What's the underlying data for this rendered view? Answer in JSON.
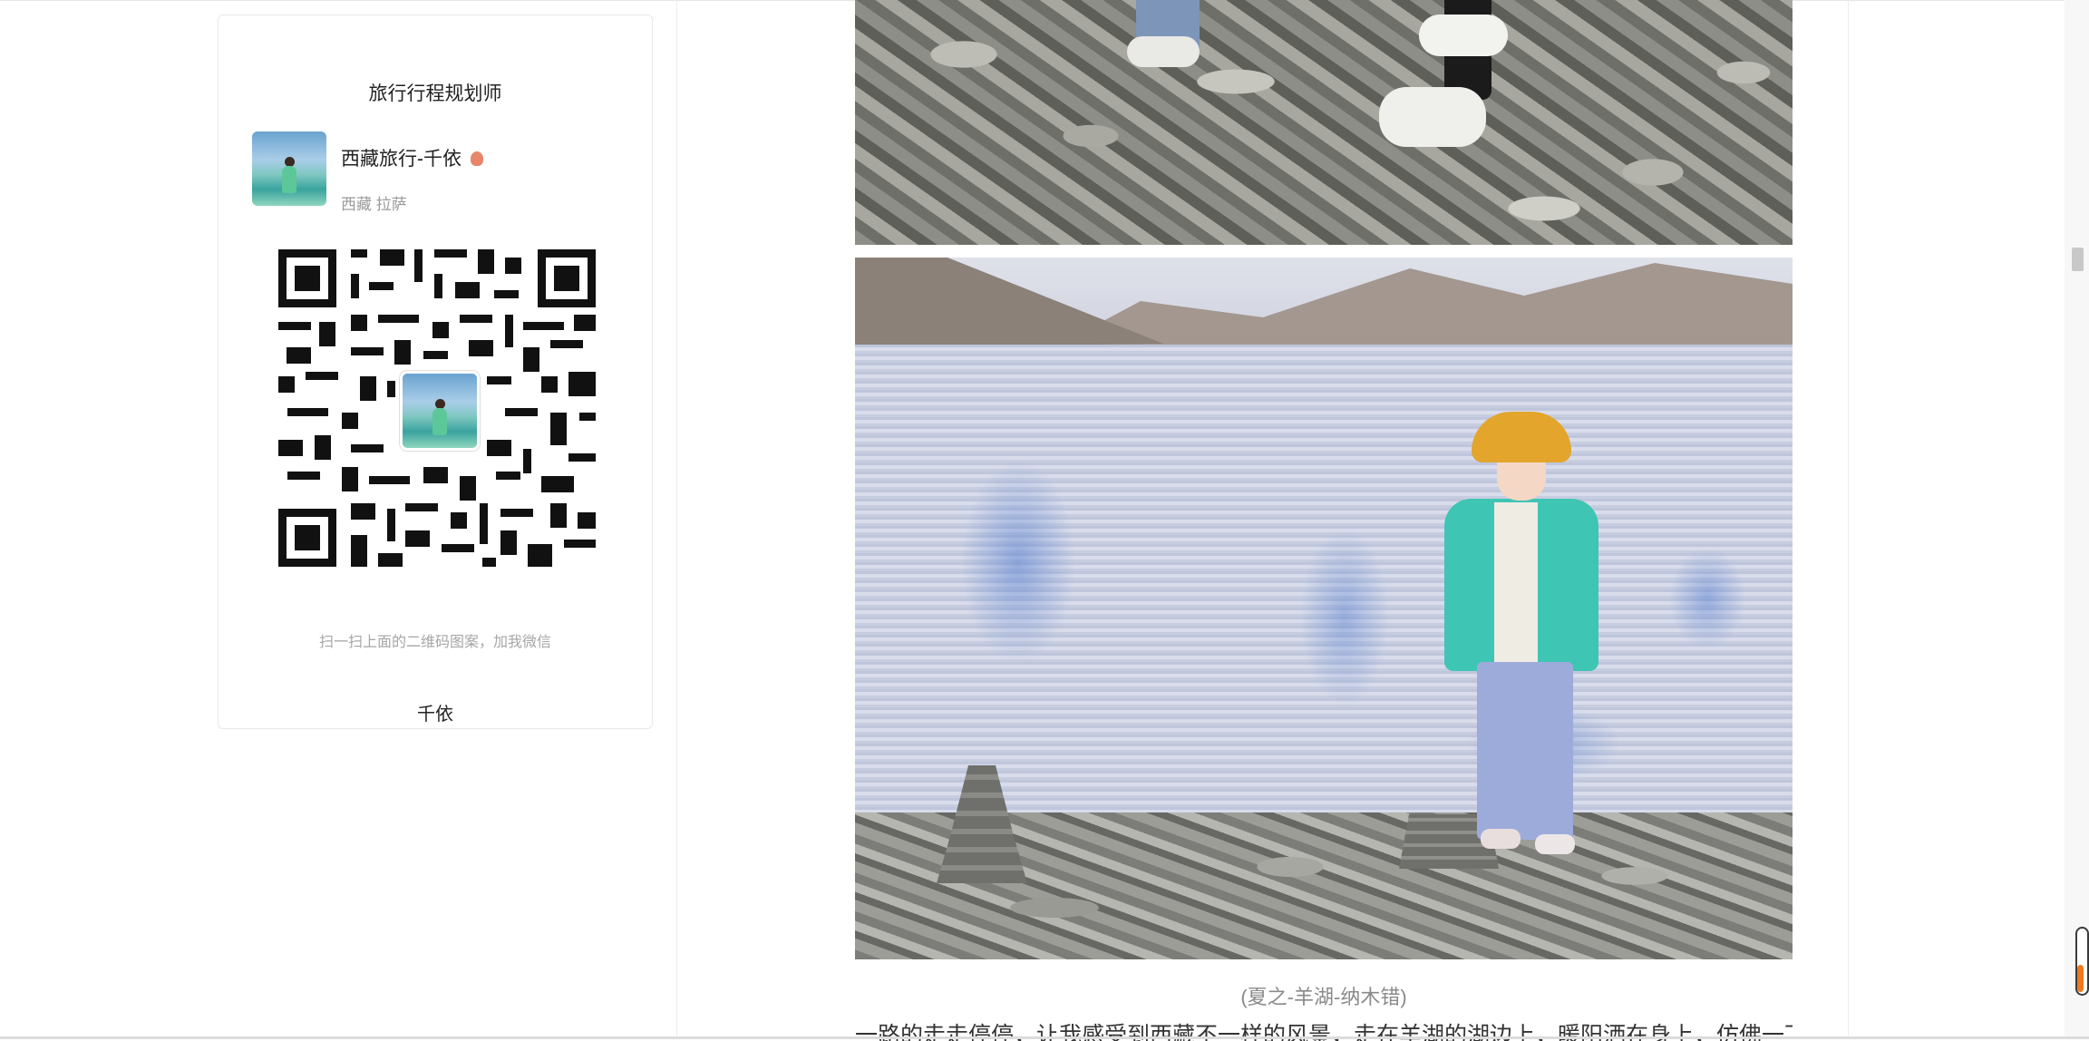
{
  "sidebar_card": {
    "title": "旅行行程规划师",
    "profile": {
      "name": "西藏旅行-千依",
      "location": "西藏 拉萨"
    },
    "qr_hint": "扫一扫上面的二维码图案，加我微信",
    "footer_name": "千依"
  },
  "article": {
    "photo1_alt": "rocky-shore-feet",
    "photo2_alt": "child-by-lake",
    "caption": "(夏之-羊湖-纳木错)",
    "paragraph": "一路的走走停停，让我感受到西藏不一样的风景，走在羊湖的湖边上，暖阳洒在身上，仿佛一下洗"
  },
  "colors": {
    "accent_progress": "#f07a1b",
    "caption": "#8a8a8a",
    "border": "#e8e8e8"
  },
  "icons": {
    "badge": "location-pin-icon",
    "scroll_progress": "scroll-progress-icon"
  }
}
